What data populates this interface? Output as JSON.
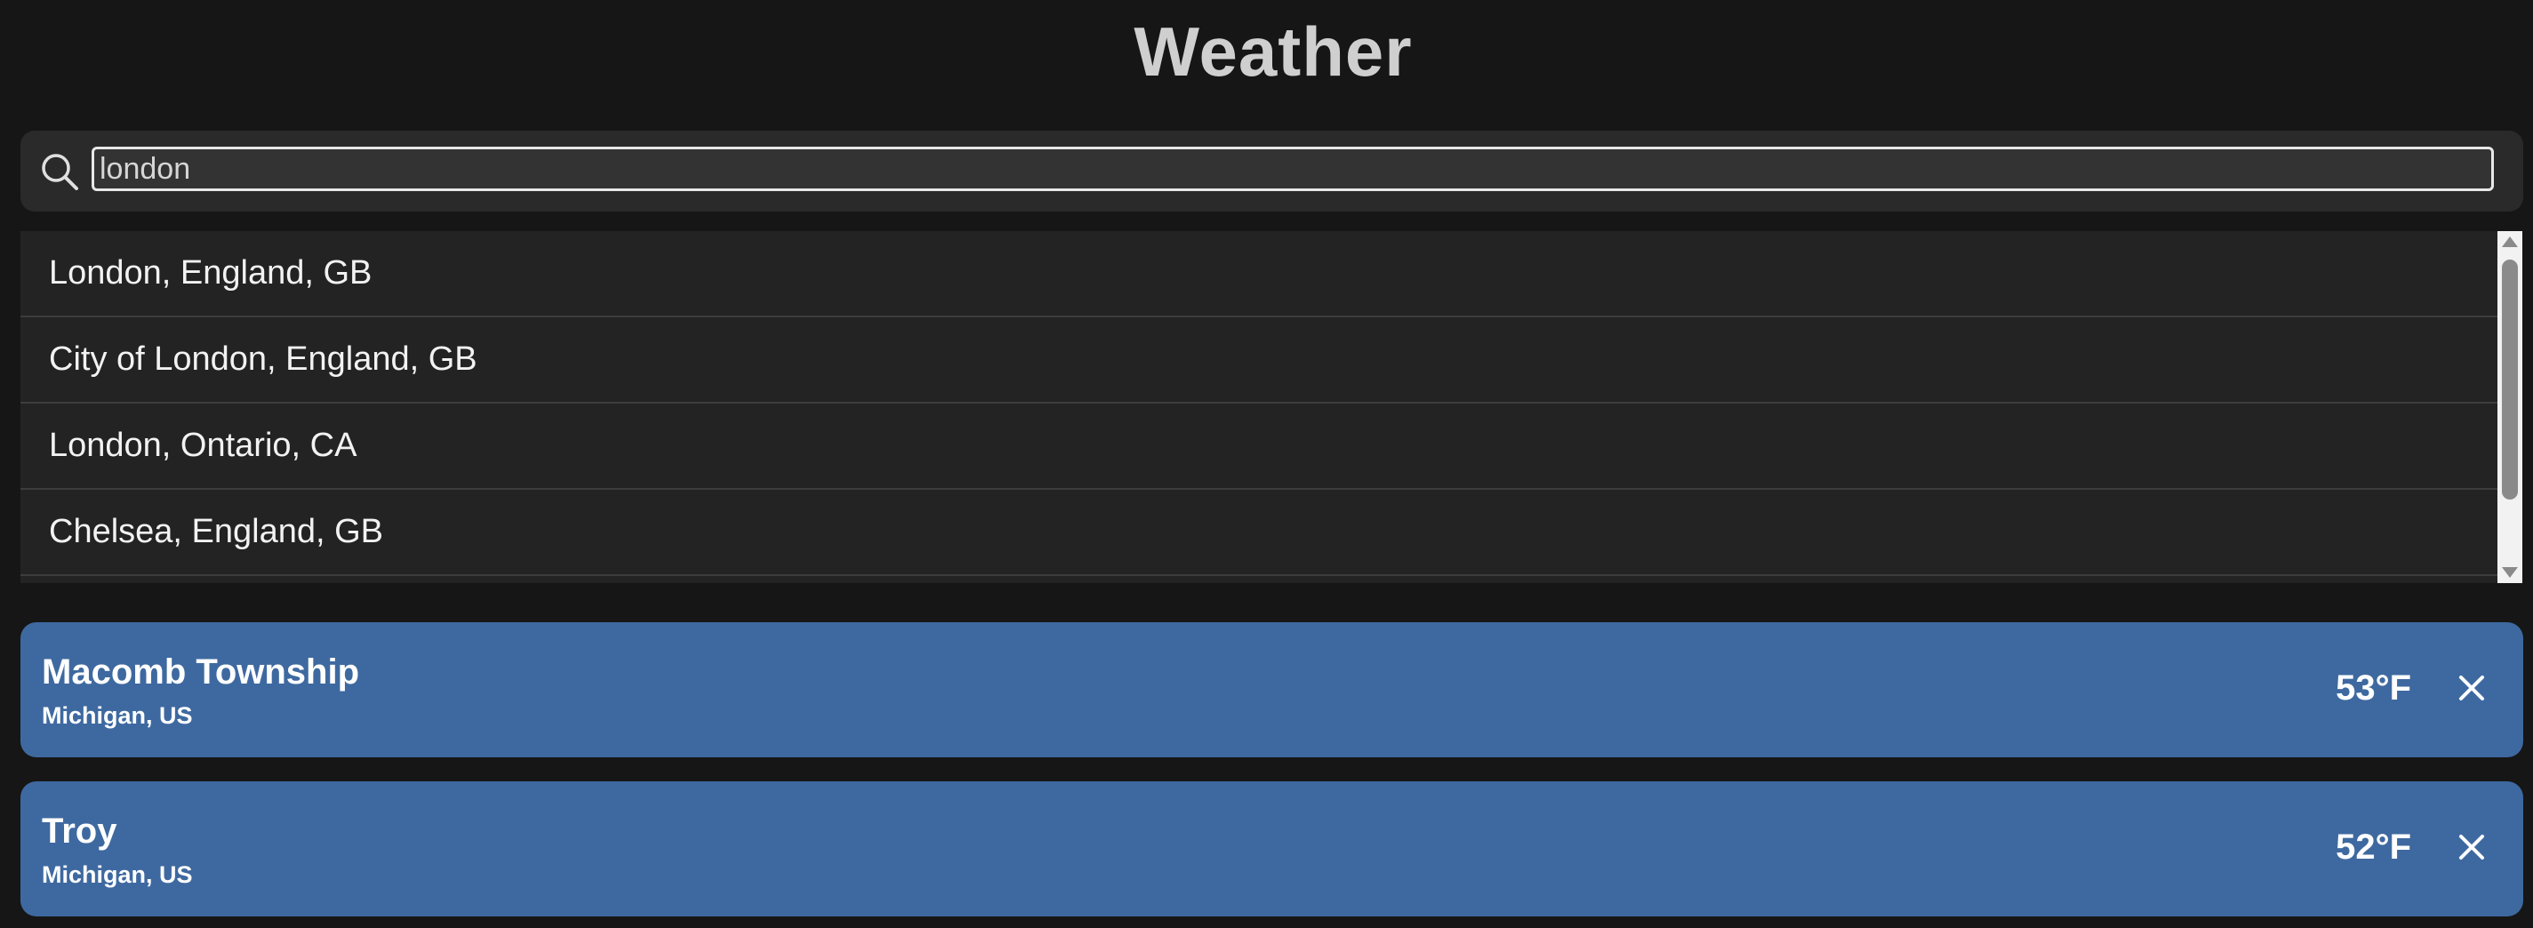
{
  "app": {
    "title": "Weather"
  },
  "search": {
    "value": "london",
    "icon": "search-icon"
  },
  "suggestions": [
    {
      "label": "London, England, GB"
    },
    {
      "label": "City of London, England, GB"
    },
    {
      "label": "London, Ontario, CA"
    },
    {
      "label": "Chelsea, England, GB"
    }
  ],
  "cities": [
    {
      "name": "Macomb Township",
      "region": "Michigan, US",
      "temp": "53°F"
    },
    {
      "name": "Troy",
      "region": "Michigan, US",
      "temp": "52°F"
    }
  ],
  "colors": {
    "background": "#161616",
    "card": "#3e69a0",
    "suggestion_bg": "#232323",
    "search_bar": "#2a2a2a",
    "title": "#cfcfcf"
  }
}
